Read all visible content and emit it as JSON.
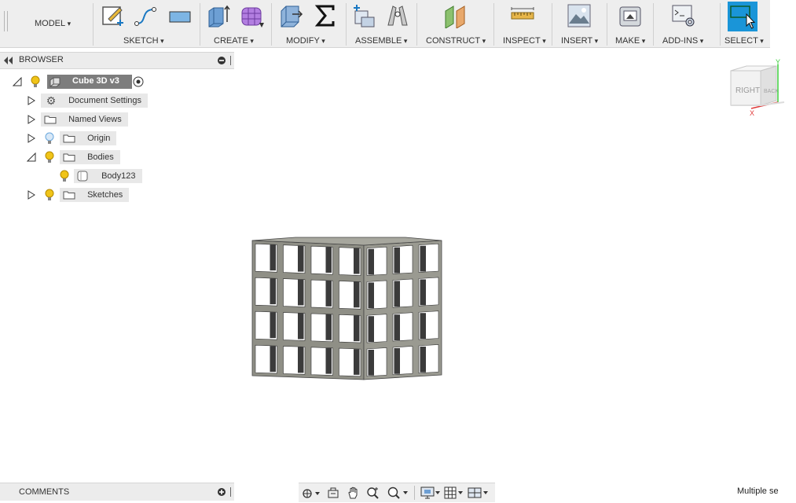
{
  "toolbar": {
    "workspace": "MODEL",
    "groups": {
      "sketch": "SKETCH",
      "create": "CREATE",
      "modify": "MODIFY",
      "assemble": "ASSEMBLE",
      "construct": "CONSTRUCT",
      "inspect": "INSPECT",
      "insert": "INSERT",
      "make": "MAKE",
      "addins": "ADD-INS",
      "select": "SELECT"
    }
  },
  "browser": {
    "title": "BROWSER",
    "root": "Cube 3D v3",
    "items": {
      "document_settings": "Document Settings",
      "named_views": "Named Views",
      "origin": "Origin",
      "bodies": "Bodies",
      "body": "Body123",
      "sketches": "Sketches"
    }
  },
  "viewcube": {
    "right": "RIGHT",
    "back": "BACK",
    "axis_y": "Y",
    "axis_x": "X"
  },
  "comments": {
    "title": "COMMENTS"
  },
  "status": {
    "text": "Multiple se"
  },
  "colors": {
    "accent": "#1a95d8",
    "bulb": "#f0c419",
    "bulb_off": "#6aa7dd",
    "cube": "#8f8f86"
  }
}
